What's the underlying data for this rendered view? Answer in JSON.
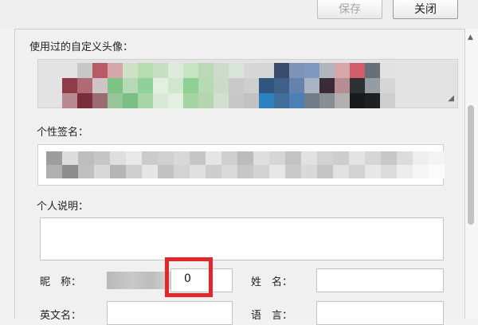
{
  "toolbar": {
    "save_label": "保存",
    "close_label": "关闭"
  },
  "sections": {
    "avatars_label": "使用过的自定义头像：",
    "signature_label": "个性签名：",
    "description_label": "个人说明："
  },
  "fields": {
    "nickname_label": "昵　称：",
    "nickname_visible_char": "0",
    "name_label": "姓　名：",
    "english_name_label": "英文名：",
    "language_label": "语　言："
  },
  "colors": {
    "highlight": "#e3262a",
    "avatar_pixels": [
      "#e4e4e4",
      "#c8c8c8",
      "#b85b67",
      "#d6a7a8",
      "#cfe2c8",
      "#b6dcb0",
      "#c9dfc3",
      "#dfe9de",
      "#c8e5c3",
      "#bcd8b6",
      "#cfdccc",
      "#d9e5da",
      "#d7d7d7",
      "#d6d6d6",
      "#394b69",
      "#7e93b6",
      "#8097bf",
      "#b2b6bc",
      "#d7a7aa",
      "#d05d6a",
      "#686f76",
      "#e2e2e2",
      "#8d3c48",
      "#b06a73",
      "#d0c4c6",
      "#7dc384",
      "#b7dab6",
      "#8fd299",
      "#e2f0e0",
      "#cfe7cb",
      "#8fd095",
      "#b7dab6",
      "#cadbc8",
      "#c9c9c9",
      "#cfcfcf",
      "#2f567f",
      "#3f5f89",
      "#6582ad",
      "#aab3c3",
      "#3b2b36",
      "#b58d93",
      "#2d3035",
      "#959ca3",
      "#d6d6d6",
      "#b98b90",
      "#7a2e3b",
      "#9c6b72",
      "#98c59a",
      "#7bbf84",
      "#a7d5a6",
      "#d8ead6",
      "#e2f0df",
      "#a4d3a4",
      "#b3d6b1",
      "#d3e0d0",
      "#c8c8c8",
      "#c2c2c2",
      "#2a83bd",
      "#416e98",
      "#4e7eb6",
      "#707c88",
      "#898e94",
      "#b4b0b2",
      "#18191b",
      "#1e1f23",
      "#cfcfcf"
    ],
    "signature_pixels": [
      "#9d9d9d",
      "#dcdcdc",
      "#bdbdbd",
      "#c6c6c6",
      "#dedede",
      "#e9e9e9",
      "#cbcbcb",
      "#d0d0d0",
      "#d8d8d8",
      "#c6c6c6",
      "#e5e5e5",
      "#cfcfcf",
      "#bcbcbc",
      "#dedede",
      "#d6d6d6",
      "#c3c3c3",
      "#e1e1e1",
      "#d2d2d2",
      "#cdcdcd",
      "#e3e3e3",
      "#d6d6d6",
      "#c8c8c8",
      "#dcdcdc",
      "#eeeeee",
      "#f4f4f4",
      "#b0b0b0",
      "#8d8d8d",
      "#c0c0c0",
      "#d9d9d9",
      "#b5b5b5",
      "#cfcfcf",
      "#e6e6e6",
      "#c2c2c2",
      "#d4d4d4",
      "#e0e0e0",
      "#cdcdcd",
      "#dadada",
      "#c7c7c7",
      "#d3d3d3",
      "#e7e7e7",
      "#cacaca",
      "#d9d9d9",
      "#c5c5c5",
      "#e2e2e2",
      "#d2d2d2",
      "#e8e8e8",
      "#dcdcdc",
      "#ededed",
      "#f6f6f6",
      "#fbfbfb"
    ]
  }
}
